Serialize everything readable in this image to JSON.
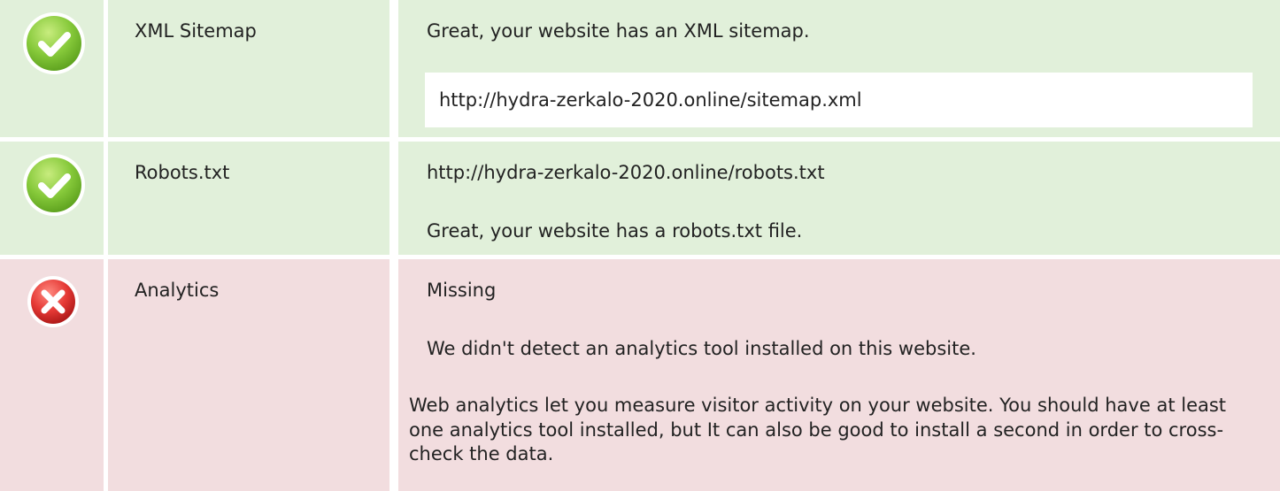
{
  "rows": [
    {
      "status": "pass",
      "icon": "check-circle-icon",
      "label": "XML Sitemap",
      "message": "Great, your website has an XML sitemap.",
      "url": "http://hydra-zerkalo-2020.online/sitemap.xml"
    },
    {
      "status": "pass",
      "icon": "check-circle-icon",
      "label": "Robots.txt",
      "url": "http://hydra-zerkalo-2020.online/robots.txt",
      "message": "Great, your website has a robots.txt file."
    },
    {
      "status": "fail",
      "icon": "error-circle-icon",
      "label": "Analytics",
      "state": "Missing",
      "message": "We didn't detect an analytics tool installed on this website.",
      "description": "Web analytics let you measure visitor activity on your website. You should have at least one analytics tool installed, but It can also be good to install a second in order to cross-check the data."
    }
  ],
  "colors": {
    "pass_bg": "#e1f0da",
    "fail_bg": "#f2dddf",
    "pass_icon": "#7cc22c",
    "fail_icon": "#e23a3a"
  }
}
